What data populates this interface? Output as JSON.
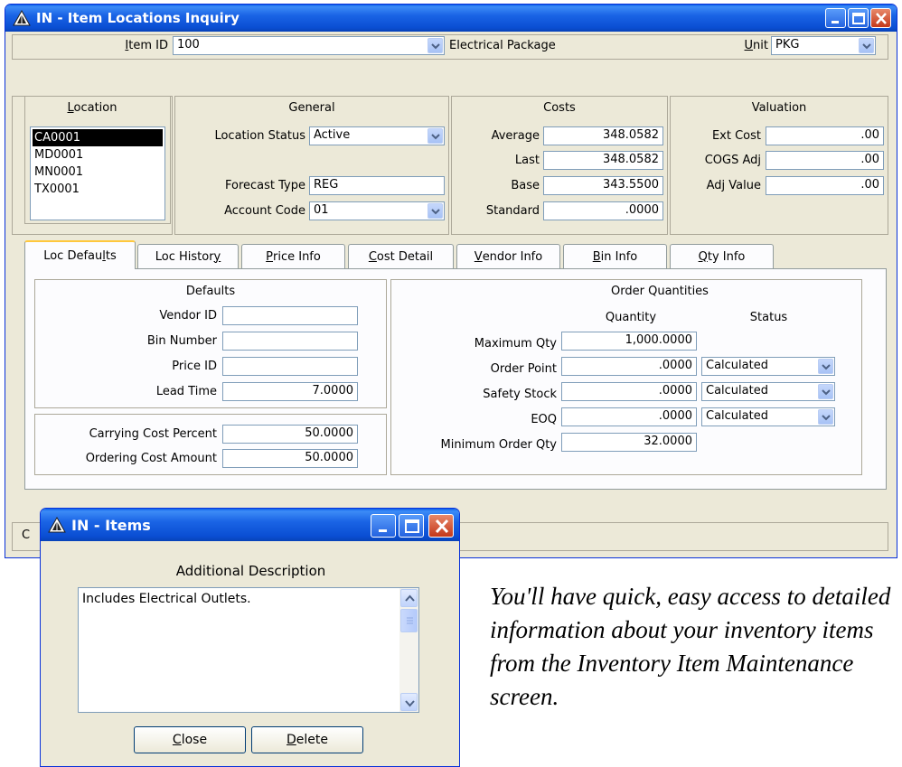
{
  "main_window": {
    "title": "IN - Item Locations Inquiry",
    "item_id_label": "Item ID",
    "item_id_value": "100",
    "item_description": "Electrical Package",
    "unit_label": "Unit",
    "unit_value": "PKG"
  },
  "location": {
    "title": "Location",
    "items": [
      "CA0001",
      "MD0001",
      "MN0001",
      "TX0001"
    ],
    "selected": "CA0001"
  },
  "general": {
    "title": "General",
    "location_status_label": "Location Status",
    "location_status_value": "Active",
    "forecast_type_label": "Forecast Type",
    "forecast_type_value": "REG",
    "account_code_label": "Account Code",
    "account_code_value": "01"
  },
  "costs": {
    "title": "Costs",
    "rows": [
      {
        "label": "Average",
        "value": "348.0582"
      },
      {
        "label": "Last",
        "value": "348.0582"
      },
      {
        "label": "Base",
        "value": "343.5500"
      },
      {
        "label": "Standard",
        "value": ".0000"
      }
    ]
  },
  "valuation": {
    "title": "Valuation",
    "rows": [
      {
        "label": "Ext Cost",
        "value": ".00"
      },
      {
        "label": "COGS Adj",
        "value": ".00"
      },
      {
        "label": "Adj Value",
        "value": ".00"
      }
    ]
  },
  "tabs": [
    "Loc Defaults",
    "Loc History",
    "Price Info",
    "Cost Detail",
    "Vendor Info",
    "Bin Info",
    "Qty Info"
  ],
  "defaults": {
    "title": "Defaults",
    "vendor_id_label": "Vendor ID",
    "vendor_id_value": "",
    "bin_number_label": "Bin Number",
    "bin_number_value": "",
    "price_id_label": "Price ID",
    "price_id_value": "",
    "lead_time_label": "Lead Time",
    "lead_time_value": "7.0000",
    "carrying_cost_label": "Carrying Cost Percent",
    "carrying_cost_value": "50.0000",
    "ordering_cost_label": "Ordering Cost Amount",
    "ordering_cost_value": "50.0000"
  },
  "order_quantities": {
    "title": "Order Quantities",
    "quantity_header": "Quantity",
    "status_header": "Status",
    "max_qty_label": "Maximum Qty",
    "max_qty_value": "1,000.0000",
    "order_point_label": "Order Point",
    "order_point_value": ".0000",
    "order_point_status": "Calculated",
    "safety_stock_label": "Safety Stock",
    "safety_stock_value": ".0000",
    "safety_stock_status": "Calculated",
    "eoq_label": "EOQ",
    "eoq_value": ".0000",
    "eoq_status": "Calculated",
    "min_order_label": "Minimum Order Qty",
    "min_order_value": "32.0000"
  },
  "status_bar_fragment": "C",
  "items_window": {
    "title": "IN - Items",
    "section_label": "Additional Description",
    "description_text": "Includes Electrical Outlets.",
    "close_label": "Close",
    "delete_label": "Delete"
  },
  "caption": "You'll have quick, easy access to detailed information about your inventory items from the Inventory Item Maintenance screen."
}
